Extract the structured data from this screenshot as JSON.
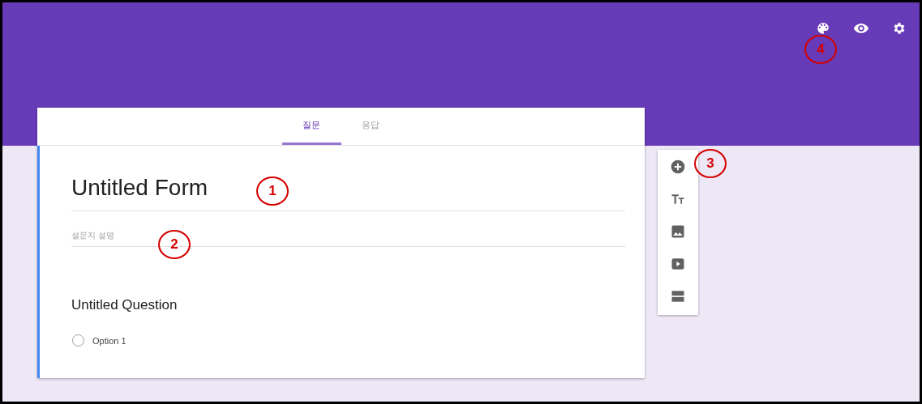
{
  "header": {
    "icons": [
      {
        "kind": "palette"
      },
      {
        "kind": "preview"
      },
      {
        "kind": "settings"
      }
    ]
  },
  "card": {
    "tabs": [
      {
        "label": "질문",
        "selected": true
      },
      {
        "label": "응답",
        "selected": false
      }
    ],
    "form_title": "Untitled Form",
    "description": {
      "placeholder": "설문지 설명"
    },
    "question": {
      "title": "Untitled Question",
      "options": [
        {
          "label": "Option 1",
          "selected": false
        }
      ]
    }
  },
  "toolbar": {
    "tools": [
      {
        "kind": "add"
      },
      {
        "kind": "title"
      },
      {
        "kind": "image"
      },
      {
        "kind": "video"
      },
      {
        "kind": "section"
      }
    ]
  },
  "annotations": [
    {
      "label": "1"
    },
    {
      "label": "2"
    },
    {
      "label": "3"
    },
    {
      "label": "4"
    }
  ]
}
